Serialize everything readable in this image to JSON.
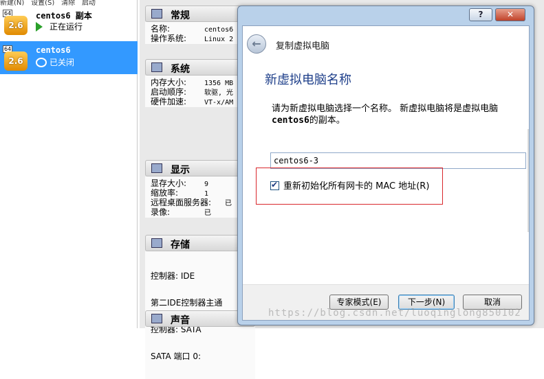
{
  "menu": {
    "items": [
      "新建(N)",
      "设置(S)",
      "清除",
      "启动"
    ]
  },
  "vm_list": {
    "items": [
      {
        "badge": "64",
        "version": "2.6",
        "name": "centos6 副本",
        "state": "正在运行",
        "selected": false
      },
      {
        "badge": "64",
        "version": "2.6",
        "name": "centos6",
        "state": "已关闭",
        "selected": true
      }
    ]
  },
  "details": {
    "general": {
      "title": "常规",
      "rows": [
        {
          "k": "名称:",
          "v": "centos6"
        },
        {
          "k": "操作系统:",
          "v": "Linux 2"
        }
      ]
    },
    "system": {
      "title": "系统",
      "rows": [
        {
          "k": "内存大小:",
          "v": "1356 MB"
        },
        {
          "k": "启动顺序:",
          "v": "软驱, 光"
        },
        {
          "k": "硬件加速:",
          "v": "VT-x/AM"
        }
      ]
    },
    "display": {
      "title": "显示",
      "rows": [
        {
          "k": "显存大小:",
          "v": "9"
        },
        {
          "k": "缩放率:",
          "v": "1"
        },
        {
          "k": "远程桌面服务器:",
          "v": "已"
        },
        {
          "k": "录像:",
          "v": "已"
        }
      ]
    },
    "storage": {
      "title": "存储",
      "rows": [
        {
          "k": "控制器: IDE",
          "v": ""
        },
        {
          "k": "  第二IDE控制器主通",
          "v": ""
        },
        {
          "k": "控制器: SATA",
          "v": ""
        },
        {
          "k": "  SATA 端口 0:",
          "v": ""
        }
      ]
    },
    "audio": {
      "title": "声音"
    }
  },
  "dialog": {
    "help_label": "?",
    "close_label": "✕",
    "back_label": "←",
    "wizard_title": "复制虚拟电脑",
    "heading": "新虚拟电脑名称",
    "desc_part1": "请为新虚拟电脑选择一个名称。 新虚拟电脑将是虚拟电脑 ",
    "desc_bold": "centos6",
    "desc_part2": "的副本。",
    "name_value": "centos6-3",
    "mac_label": "重新初始化所有网卡的 MAC 地址(R)",
    "mac_checked": true,
    "buttons": {
      "expert": "专家模式(E)",
      "next": "下一步(N)",
      "cancel": "取消"
    }
  },
  "watermark": "https://blog.csdn.net/luoqinglong850102"
}
